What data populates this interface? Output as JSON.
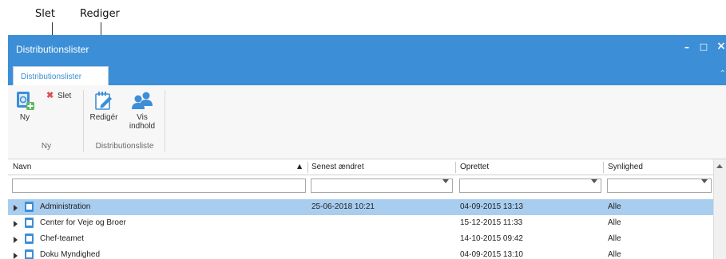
{
  "callouts": {
    "slet": "Slet",
    "rediger": "Rediger"
  },
  "window": {
    "title": "Distributionslister",
    "controls": {
      "minimize": "–",
      "maximize": "□",
      "close": "×"
    }
  },
  "ribbon": {
    "tab": "Distributionslister",
    "buttons": {
      "new": "Ny",
      "delete": "Slet",
      "edit": "Redigér",
      "show_content_line1": "Vis",
      "show_content_line2": "indhold"
    },
    "groups": {
      "new": "Ny",
      "list": "Distributionsliste"
    },
    "icons": {
      "new": "new-list-icon",
      "delete": "red-x-icon",
      "edit": "edit-note-icon",
      "show_content": "people-icon"
    }
  },
  "grid": {
    "columns": [
      {
        "label": "Navn",
        "sort": "ascending"
      },
      {
        "label": "Senest ændret"
      },
      {
        "label": "Oprettet"
      },
      {
        "label": "Synlighed"
      }
    ],
    "filters": {
      "name": "",
      "modified": "",
      "created": "",
      "visibility": ""
    },
    "rows": [
      {
        "name": "Administration",
        "modified": "25-06-2018 10:21",
        "created": "04-09-2015 13:13",
        "visibility": "Alle",
        "selected": true
      },
      {
        "name": "Center for Veje og Broer",
        "modified": "",
        "created": "15-12-2015 11:33",
        "visibility": "Alle",
        "selected": false
      },
      {
        "name": "Chef-teamet",
        "modified": "",
        "created": "14-10-2015 09:42",
        "visibility": "Alle",
        "selected": false
      },
      {
        "name": "Doku Myndighed",
        "modified": "",
        "created": "04-09-2015 13:10",
        "visibility": "Alle",
        "selected": false
      }
    ]
  },
  "colors": {
    "accent": "#3c8fd6",
    "selected_row": "#a9cdef",
    "delete_red": "#d9534f"
  }
}
